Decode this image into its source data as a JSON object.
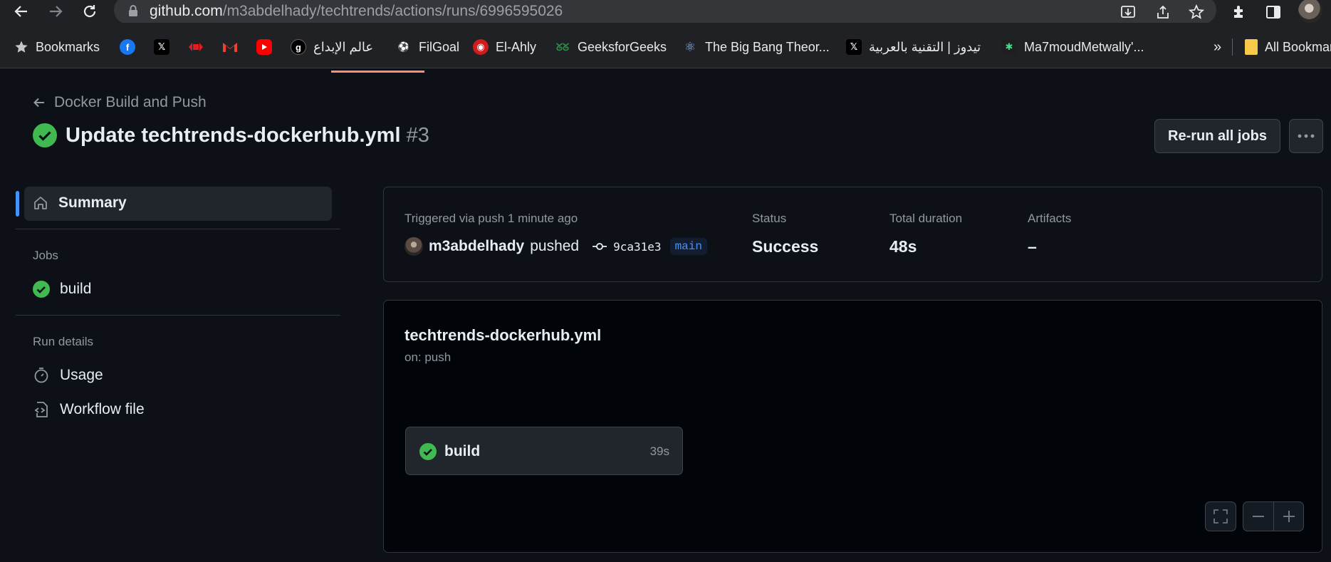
{
  "browser": {
    "url_host": "github.com",
    "url_path": "/m3abdelhady/techtrends/actions/runs/6996595026",
    "bookmarks": [
      {
        "label": "Bookmarks",
        "icon": "star-icon"
      },
      {
        "label": "",
        "icon": "facebook-icon",
        "color": "#1877f2"
      },
      {
        "label": "",
        "icon": "x-icon",
        "color": "#000000"
      },
      {
        "label": "",
        "icon": "red-logo-icon",
        "color": "#e31b23"
      },
      {
        "label": "",
        "icon": "gmail-icon",
        "color": "#ea4335"
      },
      {
        "label": "",
        "icon": "youtube-icon",
        "color": "#ff0000"
      },
      {
        "label": "عالم الإبداع",
        "icon": "g-logo-icon",
        "color": "#000000"
      },
      {
        "label": "FilGoal",
        "icon": "filgoal-icon",
        "color": "#f5a623"
      },
      {
        "label": "El-Ahly",
        "icon": "ahly-icon",
        "color": "#d01c1c"
      },
      {
        "label": "GeeksforGeeks",
        "icon": "gfg-icon",
        "color": "#2f8d46"
      },
      {
        "label": "The Big Bang Theor...",
        "icon": "atom-icon",
        "color": "#5aa0d8"
      },
      {
        "label": "تيدوز | التقنية بالعربية",
        "icon": "x-icon",
        "color": "#000000"
      },
      {
        "label": "Ma7moudMetwally'...",
        "icon": "hashnode-icon",
        "color": "#1f1f1f"
      }
    ],
    "overflow_label": "»",
    "all_bookmarks_label": "All Bookmarks"
  },
  "header": {
    "back_label": "Docker Build and Push",
    "title": "Update techtrends-dockerhub.yml",
    "run_number": "#3",
    "rerun_label": "Re-run all jobs",
    "more_label": "···"
  },
  "sidebar": {
    "summary_label": "Summary",
    "jobs_heading": "Jobs",
    "jobs": [
      {
        "label": "build",
        "status": "success"
      }
    ],
    "run_details_heading": "Run details",
    "usage_label": "Usage",
    "workflow_file_label": "Workflow file"
  },
  "summary": {
    "trigger_label": "Triggered via push 1 minute ago",
    "actor": "m3abdelhady",
    "action": "pushed",
    "commit_sha": "9ca31e3",
    "branch": "main",
    "status_label": "Status",
    "status_value": "Success",
    "duration_label": "Total duration",
    "duration_value": "48s",
    "artifacts_label": "Artifacts",
    "artifacts_value": "–"
  },
  "workflow": {
    "name": "techtrends-dockerhub.yml",
    "trigger": "on: push",
    "job": {
      "label": "build",
      "duration": "39s"
    }
  },
  "colors": {
    "success": "#3fb950",
    "accent": "#4493f8",
    "background": "#0d1117"
  }
}
